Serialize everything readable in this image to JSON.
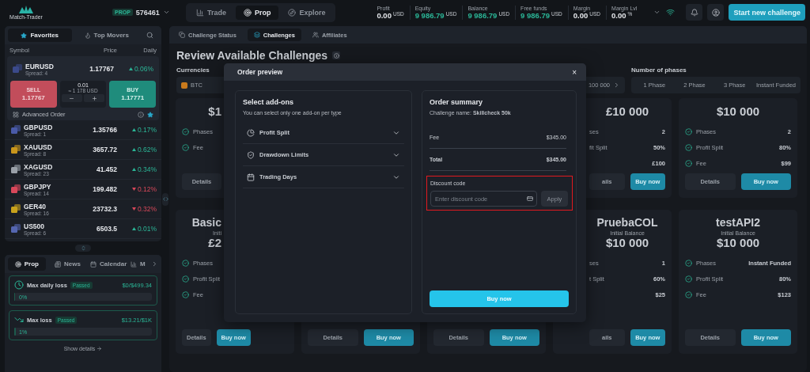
{
  "top_bar": {
    "logo": "Match-Trader",
    "account_badge": "PROP",
    "account_number": "576461",
    "nav": [
      {
        "label": "Trade",
        "selected": false
      },
      {
        "label": "Prop",
        "selected": true
      },
      {
        "label": "Explore",
        "selected": false
      }
    ],
    "stats": [
      {
        "label": "Profit",
        "value": "0.00",
        "unit": "USD",
        "highlighted": false
      },
      {
        "label": "Equity",
        "value": "9 986.79",
        "unit": "USD",
        "highlighted": true
      },
      {
        "label": "Balance",
        "value": "9 986.79",
        "unit": "USD",
        "highlighted": true
      },
      {
        "label": "Free funds",
        "value": "9 986.79",
        "unit": "USD",
        "highlighted": true
      },
      {
        "label": "Margin",
        "value": "0.00",
        "unit": "USD",
        "highlighted": false
      },
      {
        "label": "Margin Lvl",
        "value": "0.00",
        "unit": "%",
        "highlighted": false
      }
    ],
    "start_button": "Start new challenge"
  },
  "watchlist": {
    "tabs": [
      {
        "label": "Favorites",
        "selected": true
      },
      {
        "label": "Top Movers",
        "selected": false
      }
    ],
    "columns": [
      "Symbol",
      "Price",
      "Daily"
    ],
    "featured": {
      "symbol": "EURUSD",
      "spread": "Spread: 4",
      "price": "1.17767",
      "change": "0.06%",
      "rising": true,
      "color": "#3b4a8a",
      "sell_label": "SELL",
      "sell_price": "1.17767",
      "volume": "0.01",
      "volume_value": "≈ 1 178 USD",
      "buy_label": "BUY",
      "buy_price": "1.17771",
      "advanced": "Advanced Order"
    },
    "instruments": [
      {
        "symbol": "GBPUSD",
        "spread": "Spread: 1",
        "price": "1.35766",
        "change": "0.17%",
        "rising": true,
        "color": "#4a5aa8"
      },
      {
        "symbol": "XAUUSD",
        "spread": "Spread: 8",
        "price": "3657.72",
        "change": "0.62%",
        "rising": true,
        "color": "#c9961c"
      },
      {
        "symbol": "XAGUSD",
        "spread": "Spread: 23",
        "price": "41.452",
        "change": "0.34%",
        "rising": true,
        "color": "#9aa0a8"
      },
      {
        "symbol": "GBPJPY",
        "spread": "Spread: 14",
        "price": "199.482",
        "change": "0.12%",
        "rising": false,
        "color": "#d8485a"
      },
      {
        "symbol": "GER40",
        "spread": "Spread: 16",
        "price": "23732.3",
        "change": "0.32%",
        "rising": false,
        "color": "#c8a21c"
      },
      {
        "symbol": "US500",
        "spread": "Spread: 6",
        "price": "6503.5",
        "change": "0.01%",
        "rising": true,
        "color": "#5566b0"
      }
    ]
  },
  "bottom_panel": {
    "tabs": [
      {
        "label": "Prop",
        "selected": true
      },
      {
        "label": "News",
        "selected": false
      },
      {
        "label": "Calendar",
        "selected": false
      },
      {
        "label": "M",
        "selected": false
      }
    ],
    "limits": [
      {
        "title": "Max daily loss",
        "badge": "Passed",
        "amount": "$0/$499.34",
        "level": 0,
        "reading": "0%"
      },
      {
        "title": "Max loss",
        "badge": "Passed",
        "amount": "$13.21/$1K",
        "level": 0.01,
        "reading": "1%"
      }
    ],
    "show_details": "Show details"
  },
  "main": {
    "tabs": [
      {
        "label": "Challenge Status",
        "selected": false
      },
      {
        "label": "Challenges",
        "selected": true
      },
      {
        "label": "Affiliates",
        "selected": false
      }
    ],
    "heading": "Review Available Challenges",
    "currencies": {
      "label": "Currencies",
      "first": "BTC",
      "last": "100 000"
    },
    "phases": {
      "label": "Number of phases",
      "options": [
        {
          "label": "1 Phase",
          "selected": false
        },
        {
          "label": "2 Phase",
          "selected": false
        },
        {
          "label": "3 Phase",
          "selected": false
        },
        {
          "label": "Instant Funded",
          "selected": false
        }
      ]
    },
    "card_rows": [
      [
        {
          "kind": "right-covered",
          "amount": "$1",
          "features": [
            {
              "label": "Phases"
            },
            {
              "label": "Fee"
            }
          ],
          "buttons": [
            {
              "label": "Details",
              "kind": "secondary"
            }
          ]
        },
        {
          "kind": "left-covered",
          "amount": "£10 000",
          "features": [
            {
              "label": "ses",
              "value": "2"
            },
            {
              "label": "fit Split",
              "value": "50%"
            },
            {
              "value": "£100"
            }
          ],
          "buttons": [
            {
              "label": "ails",
              "kind": "secondary"
            },
            {
              "label": "Buy now",
              "kind": "primary"
            }
          ]
        },
        {
          "kind": "full",
          "amount": "$10 000",
          "features": [
            {
              "label": "Phases",
              "value": "2"
            },
            {
              "label": "Profit Split",
              "value": "80%"
            },
            {
              "label": "Fee",
              "value": "$99"
            }
          ],
          "buttons": [
            {
              "label": "Details",
              "kind": "secondary"
            },
            {
              "label": "Buy now",
              "kind": "primary"
            }
          ]
        }
      ],
      [
        {
          "kind": "right-covered",
          "title": "Basic",
          "subtitle": "Initi",
          "amount": "£2",
          "features": [
            {
              "label": "Phases"
            },
            {
              "label": "Profit Split"
            },
            {
              "label": "Fee"
            }
          ],
          "buttons": [
            {
              "label": "Details",
              "kind": "secondary"
            },
            {
              "label": "Buy now",
              "kind": "primary"
            }
          ]
        },
        {
          "kind": "top-covered",
          "buttons": [
            {
              "label": "Details",
              "kind": "secondary"
            },
            {
              "label": "Buy now",
              "kind": "primary"
            }
          ]
        },
        {
          "kind": "top-covered",
          "buttons": [
            {
              "label": "Details",
              "kind": "secondary"
            },
            {
              "label": "Buy now",
              "kind": "primary"
            }
          ]
        },
        {
          "kind": "left-covered",
          "title": "PruebaCOL",
          "subtitle": "Initial Balance",
          "amount": "$10 000",
          "features": [
            {
              "label": "ses",
              "value": "1"
            },
            {
              "label": "t Split",
              "value": "60%"
            },
            {
              "value": "$25"
            }
          ],
          "buttons": [
            {
              "label": "ails",
              "kind": "secondary"
            },
            {
              "label": "Buy now",
              "kind": "primary"
            }
          ]
        },
        {
          "kind": "full",
          "title": "testAPI2",
          "subtitle": "Initial Balance",
          "amount": "$10 000",
          "features": [
            {
              "label": "Phases",
              "value": "Instant Funded"
            },
            {
              "label": "Profit Split",
              "value": "80%"
            },
            {
              "label": "Fee",
              "value": "$123"
            }
          ],
          "buttons": [
            {
              "label": "Details",
              "kind": "secondary"
            },
            {
              "label": "Buy now",
              "kind": "primary"
            }
          ]
        }
      ]
    ]
  },
  "modal": {
    "title": "Order preview",
    "close": "×",
    "addons": {
      "title": "Select add-ons",
      "hint": "You can select only one add-on per type",
      "items": [
        {
          "label": "Profit Split",
          "expanded": false
        },
        {
          "label": "Drawdown Limits",
          "expanded": false
        },
        {
          "label": "Trading Days",
          "expanded": false
        }
      ]
    },
    "summary": {
      "title": "Order summary",
      "challenge": "Challenge name: **Skillcheck 50k**",
      "lines": [
        {
          "label": "Fee",
          "value": "$345.00",
          "kind": "normal"
        },
        {
          "label": "Total",
          "value": "$345.00",
          "kind": "total"
        }
      ],
      "discount": {
        "label": "Discount code",
        "placeholder": "Enter discount code",
        "apply": "Apply",
        "apply_disabled": true,
        "highlight": true
      },
      "buy": "Buy now"
    }
  }
}
